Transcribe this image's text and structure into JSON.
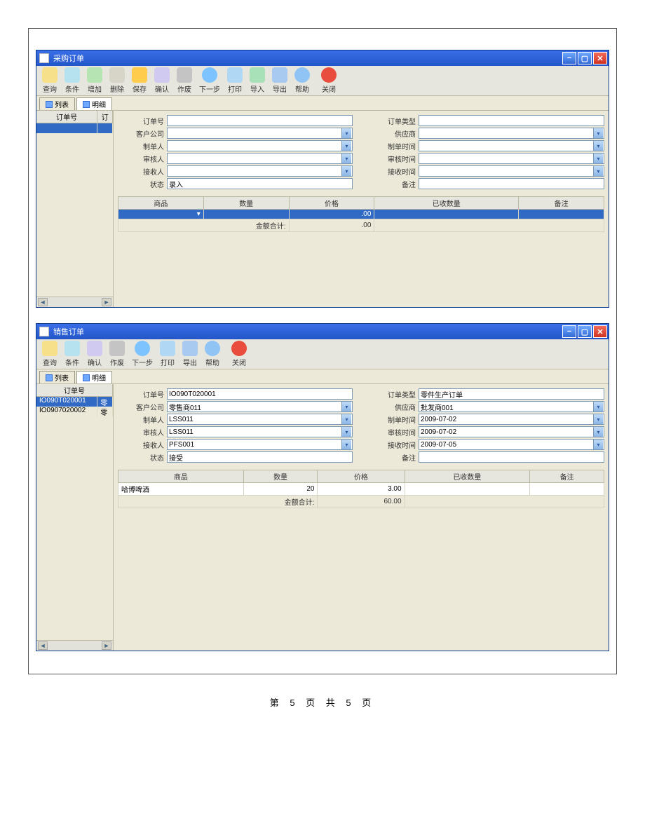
{
  "footer": "第 5 页 共 5 页",
  "win1": {
    "title": "采购订单",
    "toolbar": [
      {
        "k": "search",
        "label": "查询",
        "ico": "i-search"
      },
      {
        "k": "cond",
        "label": "条件",
        "ico": "i-cond"
      },
      {
        "k": "add",
        "label": "增加",
        "ico": "i-add"
      },
      {
        "k": "del",
        "label": "删除",
        "ico": "i-del"
      },
      {
        "k": "save",
        "label": "保存",
        "ico": "i-save"
      },
      {
        "k": "confirm",
        "label": "确认",
        "ico": "i-confirm"
      },
      {
        "k": "void",
        "label": "作废",
        "ico": "i-void"
      },
      {
        "k": "next",
        "label": "下一步",
        "ico": "i-next"
      },
      {
        "k": "print",
        "label": "打印",
        "ico": "i-print"
      },
      {
        "k": "import",
        "label": "导入",
        "ico": "i-import"
      },
      {
        "k": "export",
        "label": "导出",
        "ico": "i-export"
      },
      {
        "k": "help",
        "label": "帮助",
        "ico": "i-help"
      },
      {
        "k": "close",
        "label": "关闭",
        "ico": "i-close"
      }
    ],
    "tabs": {
      "list": "列表",
      "detail": "明细"
    },
    "left": {
      "h1": "订单号",
      "h2": "订",
      "rows": []
    },
    "form": {
      "order_no": {
        "label": "订单号",
        "value": ""
      },
      "order_type": {
        "label": "订单类型",
        "value": ""
      },
      "customer": {
        "label": "客户公司",
        "value": ""
      },
      "supplier": {
        "label": "供应商",
        "value": ""
      },
      "maker": {
        "label": "制单人",
        "value": ""
      },
      "make_time": {
        "label": "制单时间",
        "value": ""
      },
      "auditor": {
        "label": "审核人",
        "value": ""
      },
      "audit_time": {
        "label": "审核时间",
        "value": ""
      },
      "receiver": {
        "label": "接收人",
        "value": ""
      },
      "recv_time": {
        "label": "接收时间",
        "value": ""
      },
      "status": {
        "label": "状态",
        "value": "录入"
      },
      "remark": {
        "label": "备注",
        "value": ""
      }
    },
    "grid": {
      "cols": [
        "商品",
        "数量",
        "价格",
        "已收数量",
        "备注"
      ],
      "rows": [
        {
          "prod": "",
          "qty": "",
          "price": ".00",
          "recv": "",
          "rem": ""
        }
      ],
      "total_label": "金额合计:",
      "total_price": ".00"
    }
  },
  "win2": {
    "title": "销售订单",
    "toolbar": [
      {
        "k": "search",
        "label": "查询",
        "ico": "i-search"
      },
      {
        "k": "cond",
        "label": "条件",
        "ico": "i-cond"
      },
      {
        "k": "confirm",
        "label": "确认",
        "ico": "i-confirm"
      },
      {
        "k": "void",
        "label": "作废",
        "ico": "i-void"
      },
      {
        "k": "next",
        "label": "下一步",
        "ico": "i-next"
      },
      {
        "k": "print",
        "label": "打印",
        "ico": "i-print"
      },
      {
        "k": "export",
        "label": "导出",
        "ico": "i-export"
      },
      {
        "k": "help",
        "label": "帮助",
        "ico": "i-help"
      },
      {
        "k": "close",
        "label": "关闭",
        "ico": "i-close"
      }
    ],
    "tabs": {
      "list": "列表",
      "detail": "明细"
    },
    "left": {
      "h1": "订单号",
      "h2": "",
      "rows": [
        {
          "id": "IO090T020001",
          "t": "零",
          "sel": true
        },
        {
          "id": "IO0907020002",
          "t": "零",
          "sel": false
        }
      ]
    },
    "form": {
      "order_no": {
        "label": "订单号",
        "value": "IO090T020001"
      },
      "order_type": {
        "label": "订单类型",
        "value": "零件生产订单"
      },
      "customer": {
        "label": "客户公司",
        "value": "零售商011"
      },
      "supplier": {
        "label": "供应商",
        "value": "批发商001"
      },
      "maker": {
        "label": "制单人",
        "value": "LSS011"
      },
      "make_time": {
        "label": "制单时间",
        "value": "2009-07-02"
      },
      "auditor": {
        "label": "审核人",
        "value": "LSS011"
      },
      "audit_time": {
        "label": "审核时间",
        "value": "2009-07-02"
      },
      "receiver": {
        "label": "接收人",
        "value": "PFS001"
      },
      "recv_time": {
        "label": "接收时间",
        "value": "2009-07-05"
      },
      "status": {
        "label": "状态",
        "value": "接受"
      },
      "remark": {
        "label": "备注",
        "value": ""
      }
    },
    "grid": {
      "cols": [
        "商品",
        "数量",
        "价格",
        "已收数量",
        "备注"
      ],
      "rows": [
        {
          "prod": "哈博啤酒",
          "qty": "20",
          "price": "3.00",
          "recv": "",
          "rem": ""
        }
      ],
      "total_label": "金额合计:",
      "total_price": "60.00"
    }
  }
}
